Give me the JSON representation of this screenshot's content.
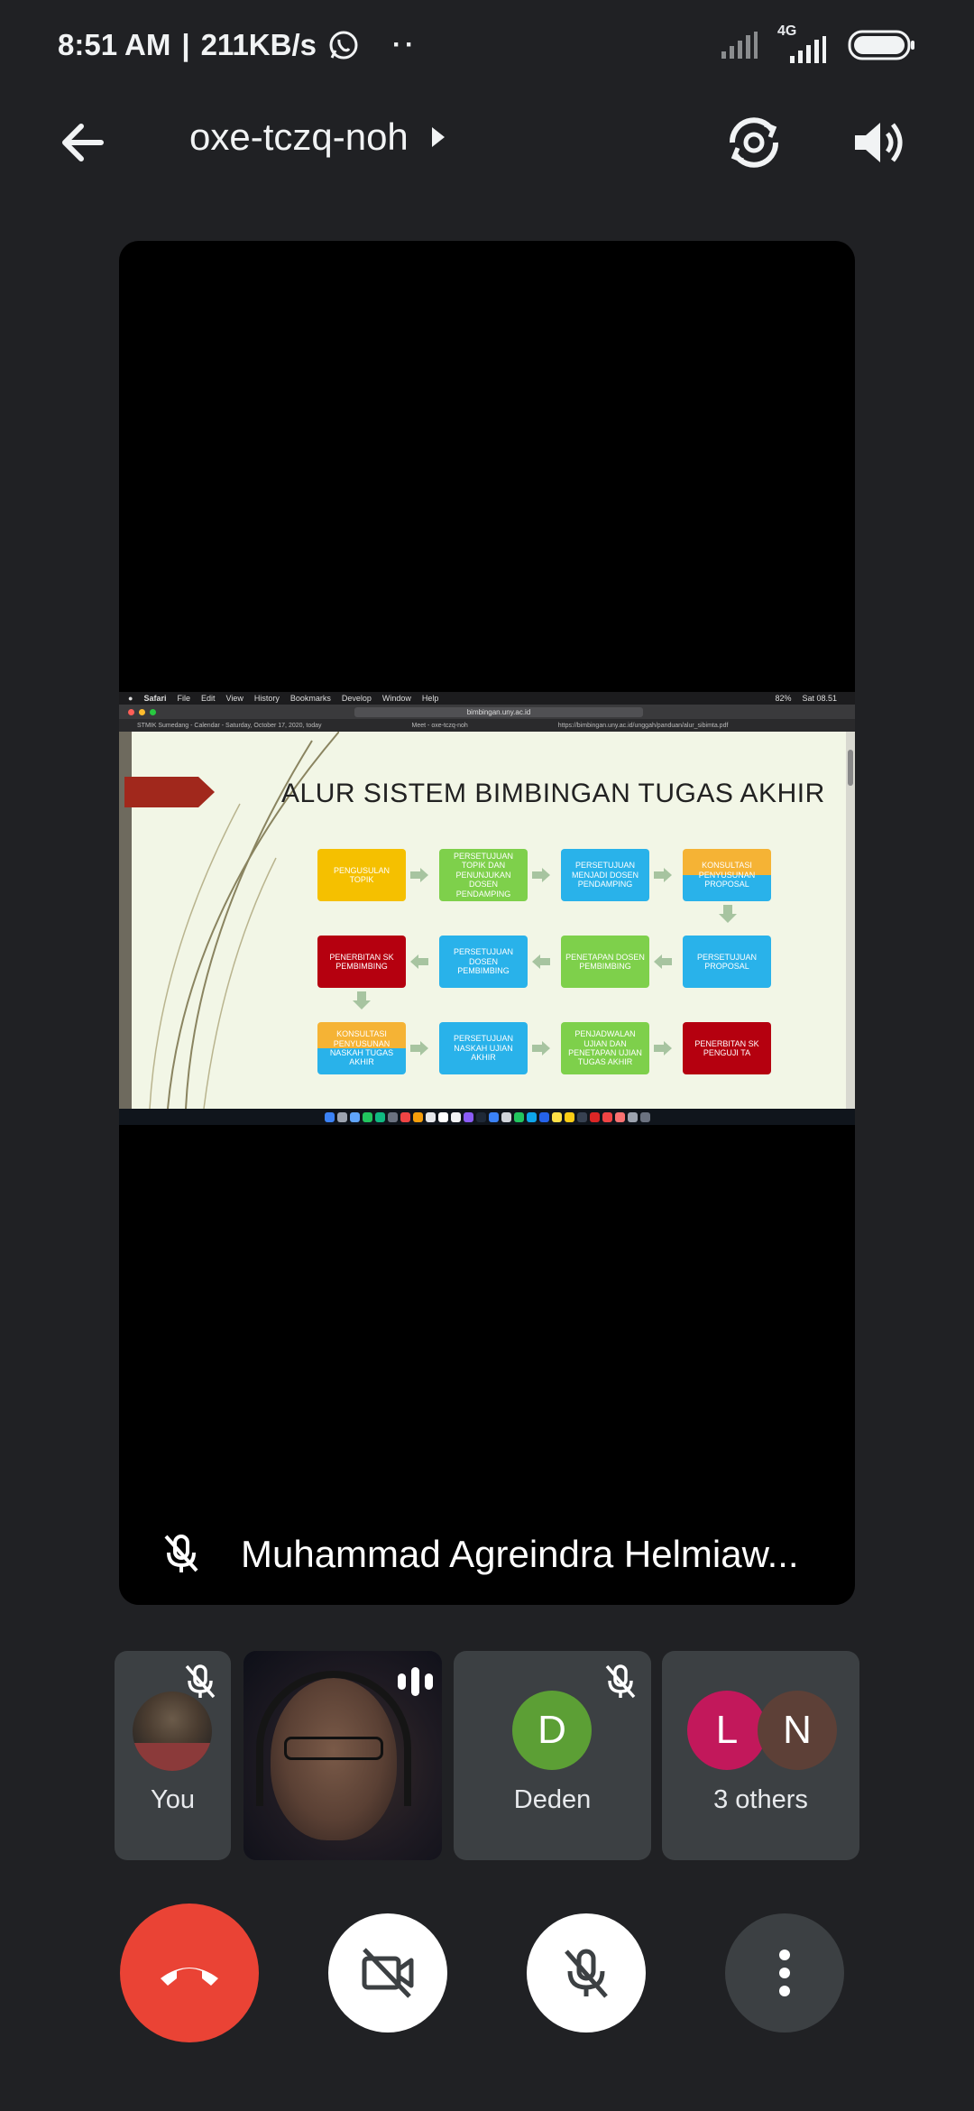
{
  "status_bar": {
    "time": "8:51 AM",
    "separator": "|",
    "speed": "211KB/s",
    "network": "4G",
    "icons": [
      "whatsapp-icon",
      "more-dots-icon",
      "signal-icon",
      "signal-4g-icon",
      "battery-icon"
    ]
  },
  "header": {
    "meeting_code": "oxe-tczq-noh",
    "icons": [
      "back-arrow-icon",
      "play-triangle-icon",
      "switch-camera-icon",
      "speaker-icon"
    ]
  },
  "main_participant": {
    "name": "Muhammad Agreindra Helmiaw...",
    "muted": true
  },
  "shared_screen": {
    "menubar": {
      "app": "Safari",
      "items": [
        "File",
        "Edit",
        "View",
        "History",
        "Bookmarks",
        "Develop",
        "Window",
        "Help"
      ],
      "battery": "82%",
      "clock": "Sat 08.51"
    },
    "url": "bimbingan.uny.ac.id",
    "tabs": [
      "STMIK Sumedang - Calendar - Saturday, October 17, 2020, today",
      "Meet - oxe-tczq-noh",
      "https://bimbingan.uny.ac.id/unggah/panduan/alur_sibimta.pdf"
    ],
    "slide": {
      "title": "ALUR SISTEM BIMBINGAN TUGAS AKHIR",
      "boxes": [
        {
          "label": "PENGUSULAN TOPIK",
          "color": "#f5c000"
        },
        {
          "label": "PERSETUJUAN TOPIK DAN PENUNJUKAN DOSEN PENDAMPING",
          "color": "#7ed04b"
        },
        {
          "label": "PERSETUJUAN MENJADI DOSEN PENDAMPING",
          "color": "#29b2ea"
        },
        {
          "label": "KONSULTASI PENYUSUNAN PROPOSAL",
          "color": "#f5b335"
        },
        {
          "label": "PERSETUJUAN PROPOSAL",
          "color": "#29b2ea"
        },
        {
          "label": "PENETAPAN DOSEN PEMBIMBING",
          "color": "#7ed04b"
        },
        {
          "label": "PERSETUJUAN DOSEN PEMBIMBING",
          "color": "#29b2ea"
        },
        {
          "label": "PENERBITAN SK PEMBIMBING",
          "color": "#b5000f"
        },
        {
          "label": "KONSULTASI PENYUSUNAN NASKAH TUGAS AKHIR",
          "color": "#f5b335"
        },
        {
          "label": "PERSETUJUAN NASKAH UJIAN AKHIR",
          "color": "#29b2ea"
        },
        {
          "label": "PENJADWALAN UJIAN DAN PENETAPAN UJIAN TUGAS AKHIR",
          "color": "#7ed04b"
        },
        {
          "label": "PENERBITAN SK PENGUJI TA",
          "color": "#b5000f"
        }
      ]
    }
  },
  "participants": [
    {
      "label": "You",
      "muted": true
    },
    {
      "label": "",
      "speaking": true
    },
    {
      "label": "Deden",
      "initial": "D",
      "color": "#5c9f35",
      "muted": true
    },
    {
      "label": "3 others",
      "initials": [
        "L",
        "N"
      ],
      "colors": [
        "#c2185b",
        "#5d4037"
      ]
    }
  ],
  "controls": {
    "icons": [
      "end-call-icon",
      "camera-off-icon",
      "mic-off-icon",
      "more-vert-icon"
    ],
    "colors": {
      "end_call": "#ea4335",
      "button_light": "#ffffff",
      "button_dark": "#3c4043"
    }
  }
}
